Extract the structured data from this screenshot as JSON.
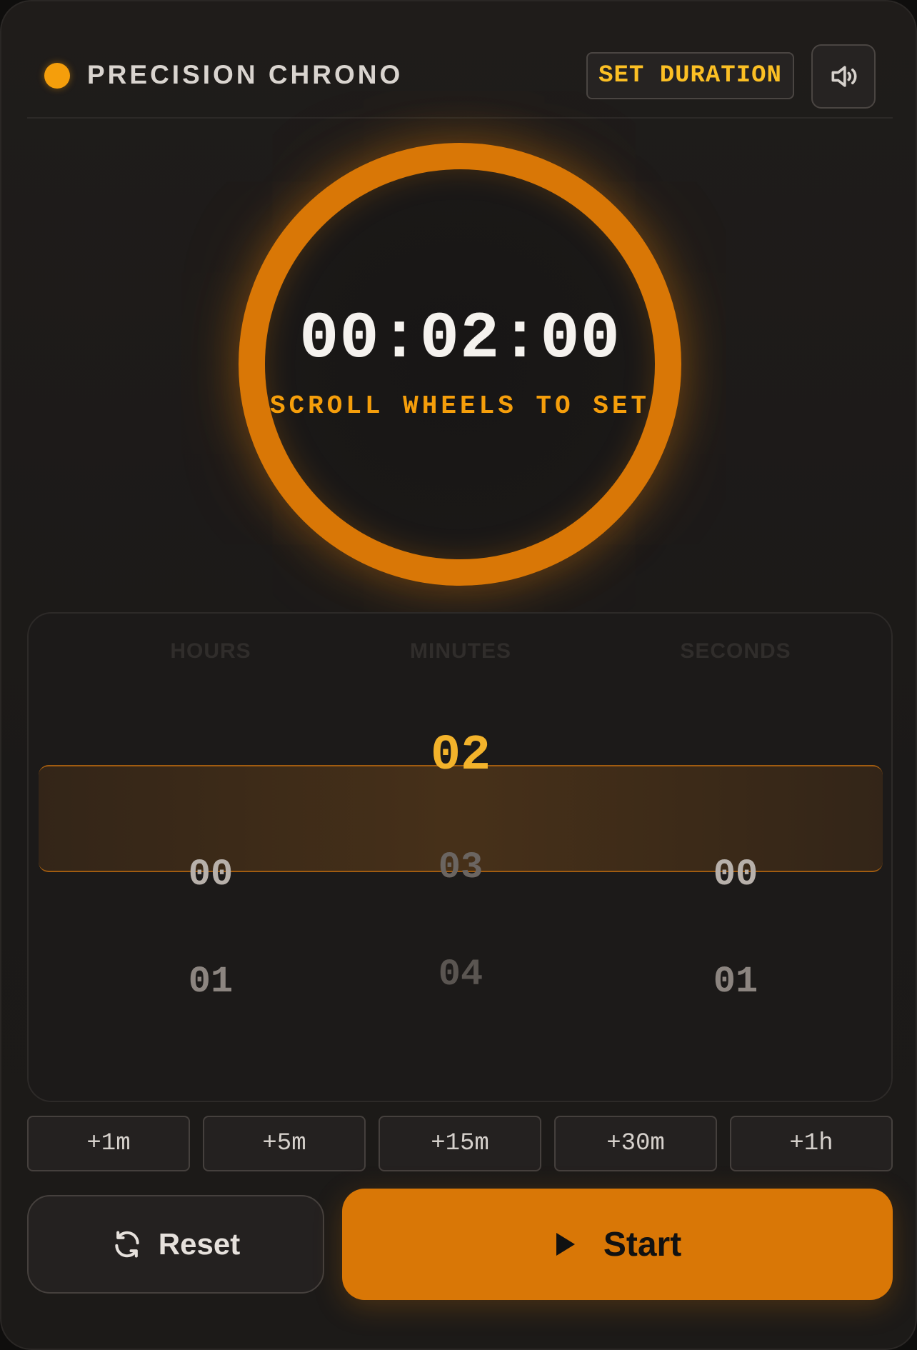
{
  "header": {
    "title": "PRECISION CHRONO",
    "set_duration_label": "SET DURATION",
    "sound_icon": "speaker-icon"
  },
  "timer": {
    "display": "00:02:00",
    "hint": "SCROLL WHEELS TO SET",
    "ring_color": "#d97706",
    "accent_color": "#f59e0b"
  },
  "wheels": {
    "labels": [
      "HOURS",
      "MINUTES",
      "SECONDS"
    ],
    "hours": {
      "selected": "00",
      "next": [
        "01"
      ]
    },
    "minutes": {
      "selected": "02",
      "next": [
        "03",
        "04"
      ]
    },
    "seconds": {
      "selected": "00",
      "next": [
        "01"
      ]
    }
  },
  "quick_add": [
    "+1m",
    "+5m",
    "+15m",
    "+30m",
    "+1h"
  ],
  "actions": {
    "reset_label": "Reset",
    "reset_icon": "refresh-icon",
    "start_label": "Start",
    "start_icon": "play-icon"
  }
}
